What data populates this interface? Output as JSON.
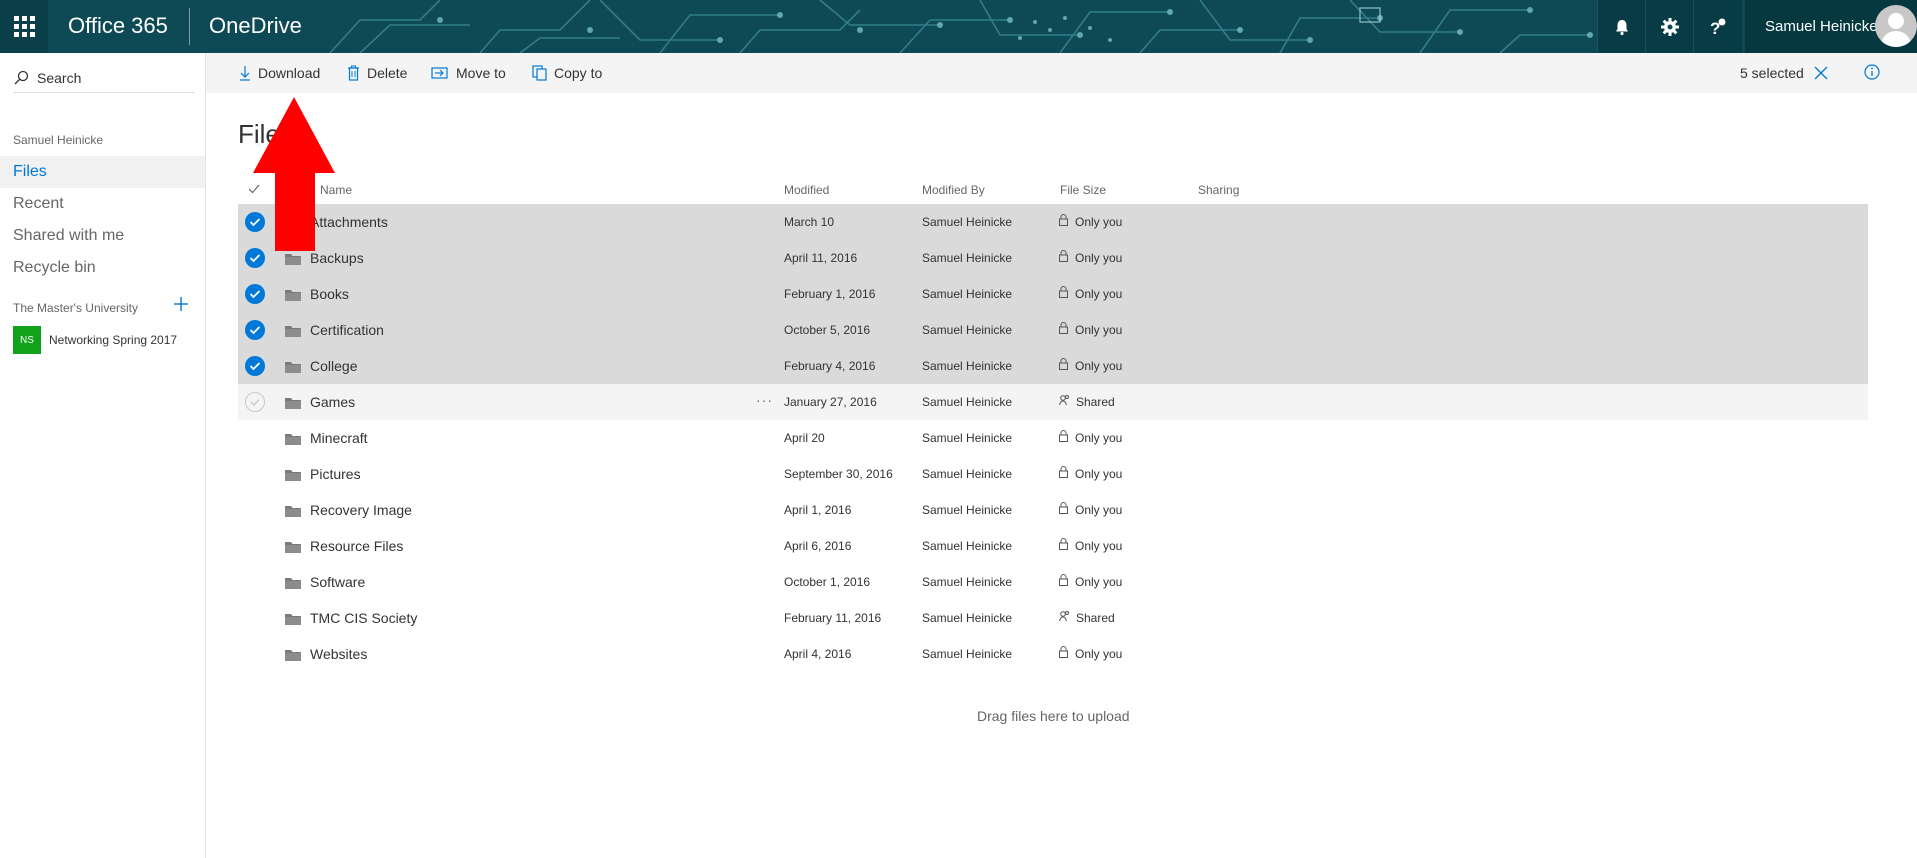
{
  "header": {
    "suite_name": "Office 365",
    "app_name": "OneDrive",
    "user_name": "Samuel Heinicke",
    "icons": [
      "app-launcher-icon",
      "bell-icon",
      "gear-icon",
      "help-icon",
      "avatar-icon"
    ]
  },
  "search": {
    "label": "Search"
  },
  "nav": {
    "owner": "Samuel Heinicke",
    "items": [
      {
        "label": "Files",
        "active": true
      },
      {
        "label": "Recent",
        "active": false
      },
      {
        "label": "Shared with me",
        "active": false
      },
      {
        "label": "Recycle bin",
        "active": false
      }
    ],
    "group_title": "The Master's University",
    "site": {
      "badge": "NS",
      "name": "Networking Spring 2017",
      "badge_color": "#11a11a"
    }
  },
  "commands": {
    "download": "Download",
    "delete": "Delete",
    "move_to": "Move to",
    "copy_to": "Copy to",
    "selected_count": "5 selected"
  },
  "main": {
    "title": "Files",
    "columns": {
      "name": "Name",
      "modified": "Modified",
      "modified_by": "Modified By",
      "file_size": "File Size",
      "sharing": "Sharing"
    },
    "rows": [
      {
        "name": "Attachments",
        "modified": "March 10",
        "modified_by": "Samuel Heinicke",
        "sharing": "Only you",
        "selected": true
      },
      {
        "name": "Backups",
        "modified": "April 11, 2016",
        "modified_by": "Samuel Heinicke",
        "sharing": "Only you",
        "selected": true
      },
      {
        "name": "Books",
        "modified": "February 1, 2016",
        "modified_by": "Samuel Heinicke",
        "sharing": "Only you",
        "selected": true
      },
      {
        "name": "Certification",
        "modified": "October 5, 2016",
        "modified_by": "Samuel Heinicke",
        "sharing": "Only you",
        "selected": true
      },
      {
        "name": "College",
        "modified": "February 4, 2016",
        "modified_by": "Samuel Heinicke",
        "sharing": "Only you",
        "selected": true
      },
      {
        "name": "Games",
        "modified": "January 27, 2016",
        "modified_by": "Samuel Heinicke",
        "sharing": "Shared",
        "selected": false,
        "hover": true
      },
      {
        "name": "Minecraft",
        "modified": "April 20",
        "modified_by": "Samuel Heinicke",
        "sharing": "Only you",
        "selected": false
      },
      {
        "name": "Pictures",
        "modified": "September 30, 2016",
        "modified_by": "Samuel Heinicke",
        "sharing": "Only you",
        "selected": false
      },
      {
        "name": "Recovery Image",
        "modified": "April 1, 2016",
        "modified_by": "Samuel Heinicke",
        "sharing": "Only you",
        "selected": false
      },
      {
        "name": "Resource Files",
        "modified": "April 6, 2016",
        "modified_by": "Samuel Heinicke",
        "sharing": "Only you",
        "selected": false
      },
      {
        "name": "Software",
        "modified": "October 1, 2016",
        "modified_by": "Samuel Heinicke",
        "sharing": "Only you",
        "selected": false
      },
      {
        "name": "TMC CIS Society",
        "modified": "February 11, 2016",
        "modified_by": "Samuel Heinicke",
        "sharing": "Shared",
        "selected": false
      },
      {
        "name": "Websites",
        "modified": "April 4, 2016",
        "modified_by": "Samuel Heinicke",
        "sharing": "Only you",
        "selected": false
      }
    ],
    "drop_hint": "Drag files here to upload"
  },
  "colors": {
    "accent": "#0078d7",
    "header_bg": "#0d4a55",
    "selected_row": "#dadada",
    "annotation_arrow": "#ff0000"
  }
}
